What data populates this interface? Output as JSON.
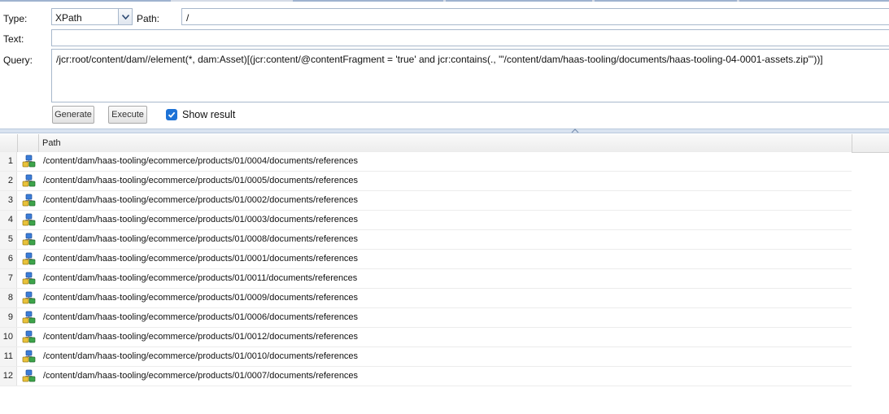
{
  "form": {
    "type_label": "Type:",
    "type_value": "XPath",
    "path_label": "Path:",
    "path_value": "/",
    "text_label": "Text:",
    "text_value": "",
    "query_label": "Query:",
    "query_value": "/jcr:root/content/dam//element(*, dam:Asset)[(jcr:content/@contentFragment = 'true' and jcr:contains(., '\"/content/dam/haas-tooling/documents/haas-tooling-04-0001-assets.zip\"'))]",
    "generate_label": "Generate",
    "execute_label": "Execute",
    "show_result_label": "Show result",
    "show_result_checked": true
  },
  "results": {
    "column_path": "Path",
    "row_icon": "node-icon",
    "rows": [
      {
        "n": "1",
        "path": "/content/dam/haas-tooling/ecommerce/products/01/0004/documents/references"
      },
      {
        "n": "2",
        "path": "/content/dam/haas-tooling/ecommerce/products/01/0005/documents/references"
      },
      {
        "n": "3",
        "path": "/content/dam/haas-tooling/ecommerce/products/01/0002/documents/references"
      },
      {
        "n": "4",
        "path": "/content/dam/haas-tooling/ecommerce/products/01/0003/documents/references"
      },
      {
        "n": "5",
        "path": "/content/dam/haas-tooling/ecommerce/products/01/0008/documents/references"
      },
      {
        "n": "6",
        "path": "/content/dam/haas-tooling/ecommerce/products/01/0001/documents/references"
      },
      {
        "n": "7",
        "path": "/content/dam/haas-tooling/ecommerce/products/01/0011/documents/references"
      },
      {
        "n": "8",
        "path": "/content/dam/haas-tooling/ecommerce/products/01/0009/documents/references"
      },
      {
        "n": "9",
        "path": "/content/dam/haas-tooling/ecommerce/products/01/0006/documents/references"
      },
      {
        "n": "10",
        "path": "/content/dam/haas-tooling/ecommerce/products/01/0012/documents/references"
      },
      {
        "n": "11",
        "path": "/content/dam/haas-tooling/ecommerce/products/01/0010/documents/references"
      },
      {
        "n": "12",
        "path": "/content/dam/haas-tooling/ecommerce/products/01/0007/documents/references"
      }
    ]
  },
  "colors": {
    "accent": "#1d72d6",
    "border": "#a8b8cc",
    "splitter": "#d9e3f0"
  }
}
